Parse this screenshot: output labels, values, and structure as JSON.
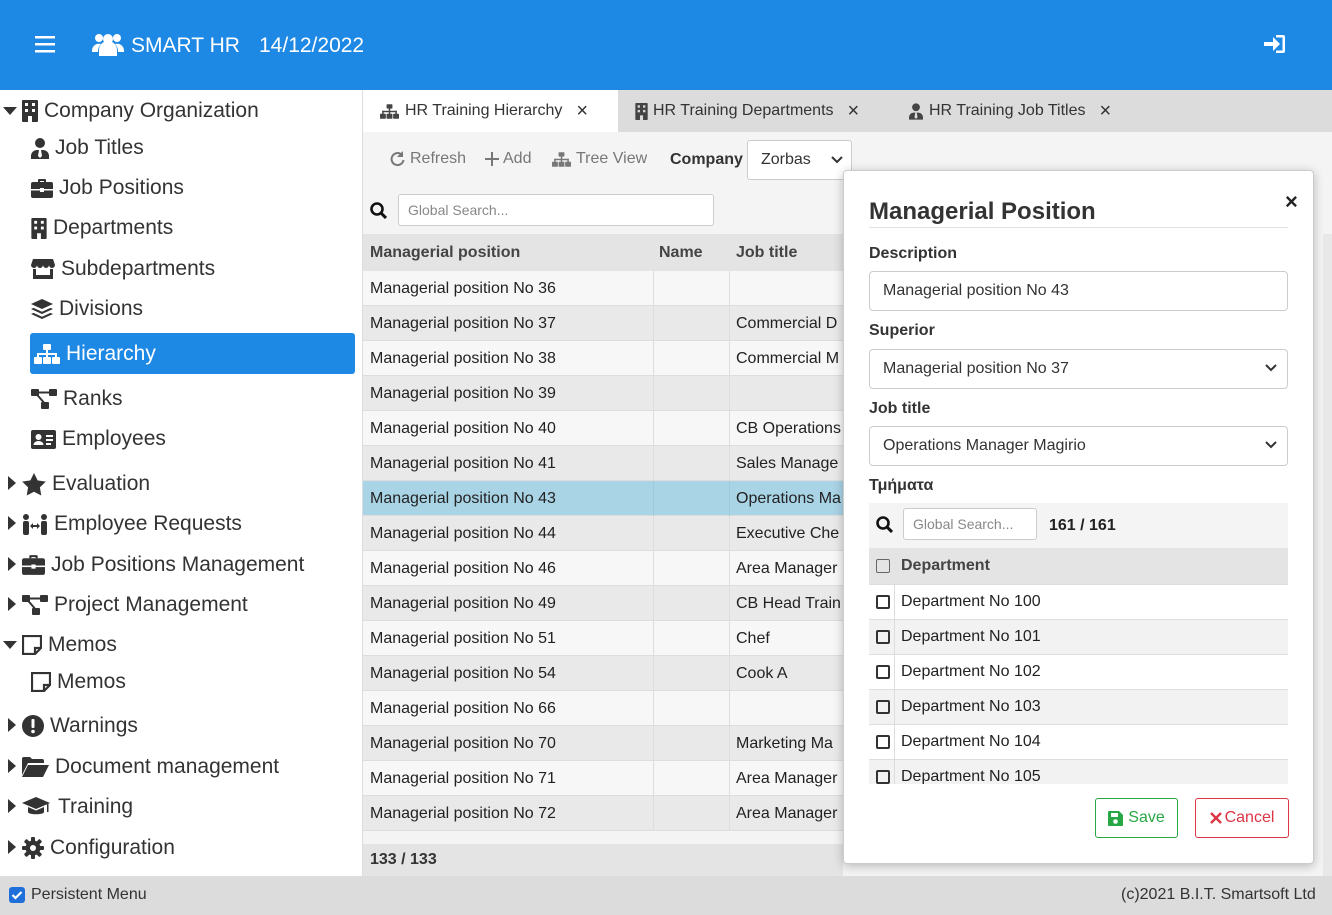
{
  "topbar": {
    "app_name": "SMART HR",
    "date": "14/12/2022",
    "icons": [
      "menu-icon",
      "users-icon",
      "sign-in-icon"
    ]
  },
  "sidebar": {
    "items": [
      {
        "label": "Company Organization",
        "icon": "building-icon",
        "expanded": true
      },
      {
        "label": "Job Titles",
        "icon": "user-tie-icon"
      },
      {
        "label": "Job Positions",
        "icon": "briefcase-icon"
      },
      {
        "label": "Departments",
        "icon": "building-icon"
      },
      {
        "label": "Subdepartments",
        "icon": "store-icon"
      },
      {
        "label": "Divisions",
        "icon": "layers-icon"
      },
      {
        "label": "Hierarchy",
        "icon": "sitemap-icon",
        "active": true
      },
      {
        "label": "Ranks",
        "icon": "project-diagram-icon"
      },
      {
        "label": "Employees",
        "icon": "id-card-icon"
      },
      {
        "label": "Evaluation",
        "icon": "star-icon",
        "expanded": false
      },
      {
        "label": "Employee Requests",
        "icon": "people-arrows-icon",
        "expanded": false
      },
      {
        "label": "Job Positions Management",
        "icon": "briefcase-icon",
        "expanded": false
      },
      {
        "label": "Project Management",
        "icon": "project-diagram-icon",
        "expanded": false
      },
      {
        "label": "Memos",
        "icon": "sticky-note-icon",
        "expanded": true
      },
      {
        "label": "Memos",
        "icon": "sticky-note-icon"
      },
      {
        "label": "Warnings",
        "icon": "exclamation-circle-icon",
        "expanded": false
      },
      {
        "label": "Document management",
        "icon": "folder-open-icon",
        "expanded": false
      },
      {
        "label": "Training",
        "icon": "graduation-cap-icon",
        "expanded": false
      },
      {
        "label": "Configuration",
        "icon": "gear-icon",
        "expanded": false
      }
    ]
  },
  "tabs": [
    {
      "label": "HR Training Hierarchy",
      "icon": "sitemap-icon",
      "selected": true
    },
    {
      "label": "HR Training Departments",
      "icon": "building-icon"
    },
    {
      "label": "HR Training Job Titles",
      "icon": "user-tie-icon"
    }
  ],
  "toolbar": {
    "refresh": "Refresh",
    "add": "Add",
    "tree_view": "Tree View",
    "company_label": "Company",
    "company_value": "Zorbas"
  },
  "grid": {
    "search_placeholder": "Global Search...",
    "columns": [
      "Managerial position",
      "Name",
      "Job title"
    ],
    "rows": [
      [
        "Managerial position No 36",
        "",
        ""
      ],
      [
        "Managerial position No 37",
        "",
        "Commercial D"
      ],
      [
        "Managerial position No 38",
        "",
        "Commercial M"
      ],
      [
        "Managerial position No 39",
        "",
        ""
      ],
      [
        "Managerial position No 40",
        "",
        "CB Operations"
      ],
      [
        "Managerial position No 41",
        "",
        "Sales Manage"
      ],
      [
        "Managerial position No 43",
        "",
        "Operations Ma"
      ],
      [
        "Managerial position No 44",
        "",
        "Executive Che"
      ],
      [
        "Managerial position No 46",
        "",
        "Area Manager"
      ],
      [
        "Managerial position No 49",
        "",
        "CB Head Train"
      ],
      [
        "Managerial position No 51",
        "",
        "Chef"
      ],
      [
        "Managerial position No 54",
        "",
        "Cook A"
      ],
      [
        "Managerial position No 66",
        "",
        ""
      ],
      [
        "Managerial position No 70",
        "",
        "Marketing Ma"
      ],
      [
        "Managerial position No 71",
        "",
        "Area Manager"
      ],
      [
        "Managerial position No 72",
        "",
        "Area Manager"
      ]
    ],
    "selected_row": "Managerial position No 43",
    "footer": "133 / 133"
  },
  "modal": {
    "title": "Managerial Position",
    "close": "×",
    "description_label": "Description",
    "description_value": "Managerial position No 43",
    "superior_label": "Superior",
    "superior_value": "Managerial position No 37",
    "jobtitle_label": "Job title",
    "jobtitle_value": "Operations Manager Magirio",
    "departments_label": "Τμήματα",
    "dept_search_placeholder": "Global Search...",
    "dept_count": "161 / 161",
    "dept_header": "Department",
    "departments": [
      "Department No 100",
      "Department No 101",
      "Department No 102",
      "Department No 103",
      "Department No 104",
      "Department No 105"
    ],
    "save": "Save",
    "cancel": "Cancel"
  },
  "bottom": {
    "persistent_menu": "Persistent Menu",
    "copyright": "(c)2021 B.I.T. Smartsoft Ltd"
  },
  "colors": {
    "primary": "#1e88e5",
    "selected_row": "#a9d4e6",
    "save": "#28a745",
    "cancel": "#dc3545"
  }
}
